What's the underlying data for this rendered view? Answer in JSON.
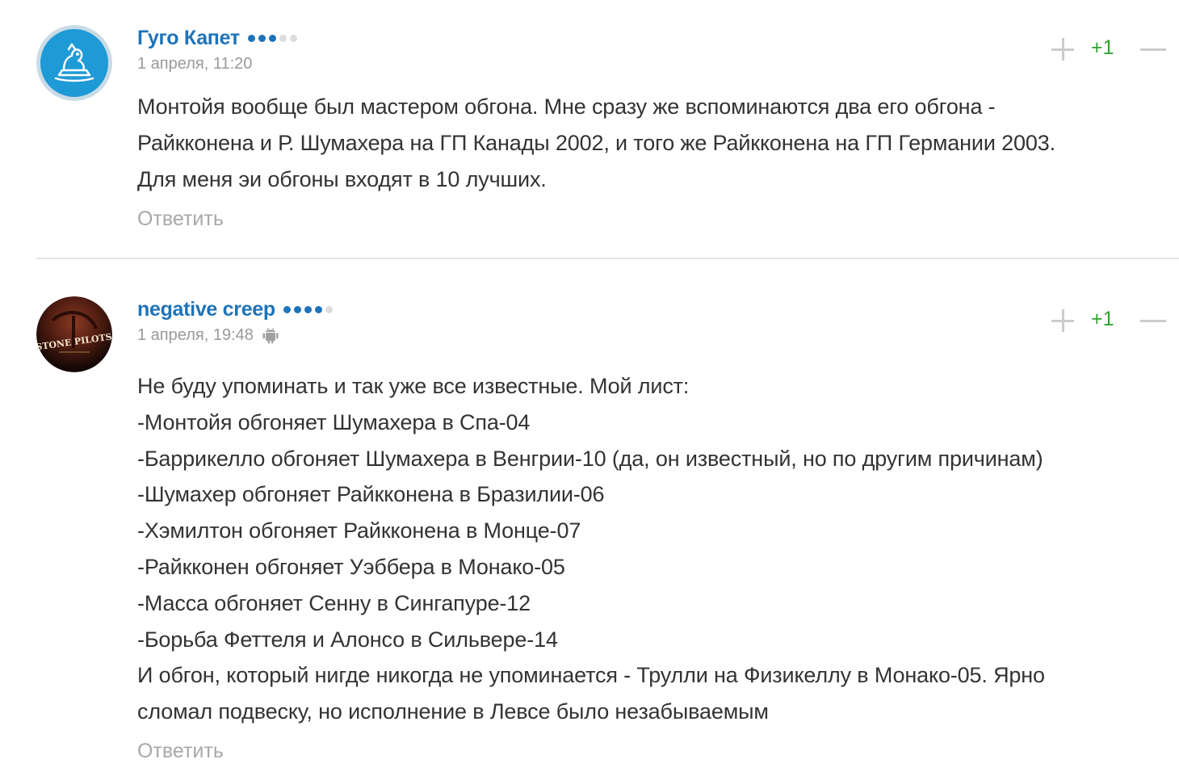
{
  "comments": [
    {
      "author": "Гуго Капет",
      "rating_level": 3,
      "rating_max": 5,
      "date": "1 апреля, 11:20",
      "device_icon": null,
      "votes": "+1",
      "lines": [
        "Монтойя вообще был мастером обгона. Мне сразу же вспоминаются два его обгона -",
        "Райкконена и Р. Шумахера на ГП Канады 2002, и того же Райкконена на ГП Германии 2003.",
        "Для меня эи обгоны входят в 10 лучших."
      ],
      "reply_label": "Ответить",
      "avatar_icon": "cartoon-avatar-icon"
    },
    {
      "author": "negative creep",
      "rating_level": 4,
      "rating_max": 5,
      "date": "1 апреля, 19:48",
      "device_icon": "android-icon",
      "votes": "+1",
      "lines": [
        "Не буду упоминать и так уже все известные. Мой лист:",
        "-Монтойя обгоняет Шумахера в Спа-04",
        "-Баррикелло обгоняет Шумахера в Венгрии-10 (да, он известный, но по другим причинам)",
        "-Шумахер обгоняет Райкконена в Бразилии-06",
        "-Хэмилтон обгоняет Райкконена в Монце-07",
        "-Райкконен обгоняет Уэббера в Монако-05",
        "-Масса обгоняет Сенну в Сингапуре-12",
        "-Борьба Феттеля и Алонсо в Сильвере-14",
        "И обгон, который нигде никогда не упоминается - Трулли на Физикеллу в Монако-05. Ярно",
        "сломал подвеску, но исполнение в Левсе было незабываемым"
      ],
      "reply_label": "Ответить",
      "avatar_icon": "stone-pilots-album-avatar",
      "avatar_text": "STONE PILOTS"
    }
  ],
  "colors": {
    "author": "#1e73b8",
    "vote_positive": "#31a231",
    "muted": "#9a9a9a",
    "text": "#333333",
    "avatar1_bg": "#1e9ad6"
  }
}
